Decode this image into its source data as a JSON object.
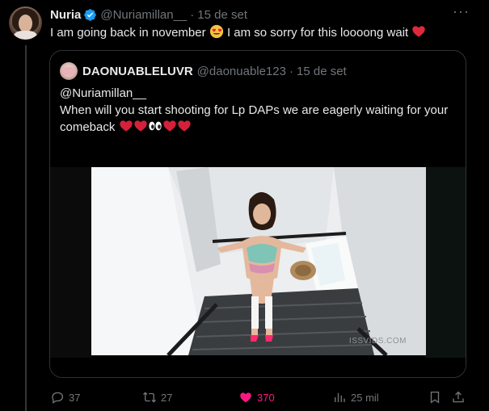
{
  "tweet": {
    "author_name": "Nuria",
    "author_handle": "@Nuriamillan__",
    "date": "15 de set",
    "separator": "·",
    "text_part1": "I am going back in november",
    "text_part2": "I am so sorry for this loooong wait",
    "icons": {
      "verified": "verified-badge-icon",
      "more": "more-icon",
      "emoji_1": "heart-eyes-emoji",
      "emoji_2": "red-heart-emoji"
    }
  },
  "quote": {
    "author_name": "DAONUABLELUVR",
    "author_handle": "@daonuable123",
    "date": "15 de set",
    "separator": "·",
    "mention": "@Nuriamillan__",
    "text_line1": "When will you start shooting for Lp DAPs we are eagerly waiting for your",
    "text_line2": "comeback",
    "emojis": [
      "red-heart",
      "red-heart",
      "eyes",
      "red-heart",
      "red-heart"
    ],
    "media_watermark": "ISSVIDS.COM"
  },
  "actions": {
    "replies": "37",
    "retweets": "27",
    "likes": "370",
    "views": "25 mil",
    "icons": [
      "reply-icon",
      "retweet-icon",
      "heart-icon",
      "views-icon",
      "bookmark-icon",
      "share-icon"
    ]
  },
  "colors": {
    "background": "#000000",
    "text": "#e7e9ea",
    "muted": "#71767b",
    "border": "#2f3336",
    "verified": "#1d9bf0",
    "like": "#f91880"
  }
}
